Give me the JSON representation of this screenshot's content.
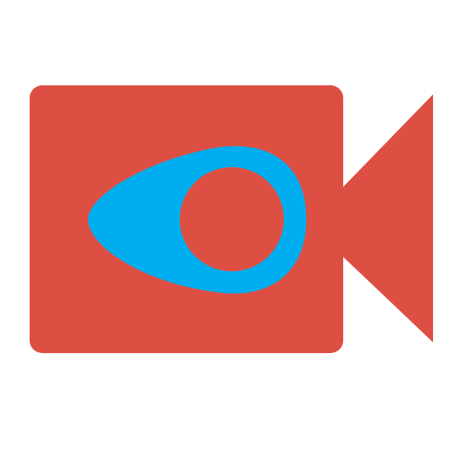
{
  "icon": {
    "name": "video-camera-app-icon",
    "colors": {
      "background": "#ffffff",
      "camera_body": "#dd4f43",
      "lens_shape": "#00aeef",
      "lens_center": "#dd4f43"
    }
  }
}
